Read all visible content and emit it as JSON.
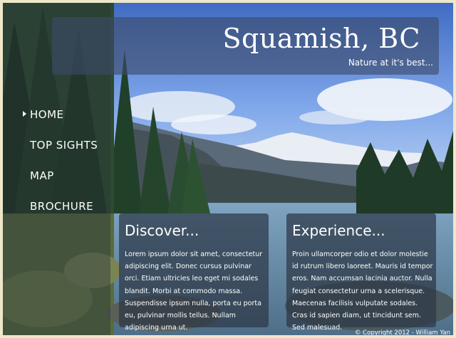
{
  "header": {
    "title": "Squamish, BC",
    "tagline": "Nature at it's best..."
  },
  "nav": {
    "items": [
      {
        "label": "HOME",
        "active": true
      },
      {
        "label": "TOP SIGHTS"
      },
      {
        "label": "MAP"
      },
      {
        "label": "BROCHURE"
      }
    ]
  },
  "panels": [
    {
      "heading": "Discover...",
      "text": "Lorem ipsum dolor sit amet, consectetur adipiscing elit. Donec cursus pulvinar orci. Etiam ultricies leo eget mi sodales blandit. Morbi at commodo massa. Suspendisse ipsum nulla, porta eu porta eu, pulvinar mollis tellus. Nullam adipiscing urna ut."
    },
    {
      "heading": "Experience...",
      "text": "Proin ullamcorper odio et dolor molestie id rutrum libero laoreet. Mauris id tempor eros. Nam accumsan lacinia auctor. Nulla feugiat consectetur urna a scelerisque. Maecenas facilisis vulputate sodales. Cras id sapien diam, ut tincidunt sem. Sed malesuad."
    }
  ],
  "footer": {
    "copyright": "© Copyright 2012 - William Yan"
  },
  "colors": {
    "frame": "#efe7c9",
    "sky": "#6e97e0",
    "overlay": "#3c4b69",
    "text": "#ffffff"
  }
}
